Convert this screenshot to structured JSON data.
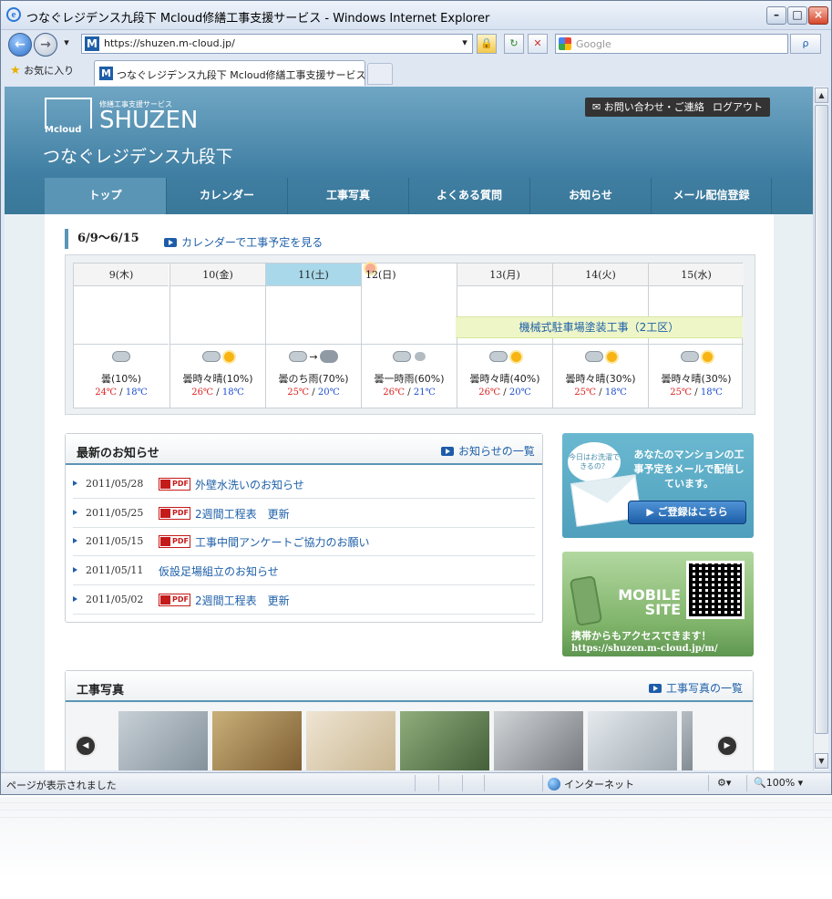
{
  "browser": {
    "window_title": "つなぐレジデンス九段下 Mcloud修繕工事支援サービス - Windows Internet Explorer",
    "url": "https://shuzen.m-cloud.jp/",
    "search_placeholder": "Google",
    "favorites_label": "お気に入り",
    "tab_title": "つなぐレジデンス九段下 Mcloud修繕工事支援サービス",
    "status_text": "ページが表示されました",
    "zone_text": "インターネット",
    "zoom_text": "100%",
    "search_button": "ρ"
  },
  "site": {
    "logo_sub": "修繕工事支援サービス",
    "logo_name": "SHUZEN",
    "logo_mcloud": "Mcloud",
    "contact_button": "お問い合わせ・ご連絡",
    "logout_button": "ログアウト",
    "residence_name": "つなぐレジデンス九段下",
    "nav": [
      "トップ",
      "カレンダー",
      "工事写真",
      "よくある質問",
      "お知らせ",
      "メール配信登録"
    ]
  },
  "week": {
    "range": "6/9〜6/15",
    "calendar_link": "カレンダーで工事予定を見る",
    "days": [
      {
        "label": "9(木)",
        "weather": "曇(10%)",
        "hi": "24℃",
        "lo": "18℃",
        "icon": "cloud"
      },
      {
        "label": "10(金)",
        "weather": "曇時々晴(10%)",
        "hi": "26℃",
        "lo": "18℃",
        "icon": "cloud-sun"
      },
      {
        "label": "11(土)",
        "weather": "曇のち雨(70%)",
        "hi": "25℃",
        "lo": "20℃",
        "icon": "cloud-then-rain"
      },
      {
        "label": "12(日)",
        "weather": "曇一時雨(60%)",
        "hi": "26℃",
        "lo": "21℃",
        "icon": "cloud-rain"
      },
      {
        "label": "13(月)",
        "weather": "曇時々晴(40%)",
        "hi": "26℃",
        "lo": "20℃",
        "icon": "cloud-sun"
      },
      {
        "label": "14(火)",
        "weather": "曇時々晴(30%)",
        "hi": "25℃",
        "lo": "18℃",
        "icon": "cloud-sun"
      },
      {
        "label": "15(水)",
        "weather": "曇時々晴(30%)",
        "hi": "25℃",
        "lo": "18℃",
        "icon": "cloud-sun"
      }
    ],
    "temp_sep": " / ",
    "event": "機械式駐車場塗装工事（2工区）"
  },
  "news": {
    "title": "最新のお知らせ",
    "list_link": "お知らせの一覧",
    "pdf_label": "PDF",
    "items": [
      {
        "date": "2011/05/28",
        "pdf": true,
        "title": "外壁水洗いのお知らせ"
      },
      {
        "date": "2011/05/25",
        "pdf": true,
        "title": "2週間工程表　更新"
      },
      {
        "date": "2011/05/15",
        "pdf": true,
        "title": "工事中間アンケートご協力のお願い"
      },
      {
        "date": "2011/05/11",
        "pdf": false,
        "title": "仮設足場組立のお知らせ"
      },
      {
        "date": "2011/05/02",
        "pdf": true,
        "title": "2週間工程表　更新"
      }
    ]
  },
  "mail_banner": {
    "bubble": "今日はお洗濯できるの？",
    "text": "あなたのマンションの工事予定をメールで配信しています。",
    "button": "ご登録はこちら"
  },
  "mobile_banner": {
    "title_line1": "MOBILE",
    "title_line2": "SITE",
    "caption": "携帯からもアクセスできます！",
    "url": "https://shuzen.m-cloud.jp/m/"
  },
  "photos": {
    "title": "工事写真",
    "list_link": "工事写真の一覧",
    "thumbs": [
      "#8a9aa6",
      "#b08a55",
      "#d9c9a9",
      "#5d7a52",
      "#8c8f92",
      "#b9c2c9",
      "#9aa2a8"
    ]
  },
  "colors": {
    "header": "#4a88ab",
    "link": "#1e5fa8",
    "sat": "#a9d8ea",
    "sun": "#f7ad94",
    "event": "#eef6c8"
  }
}
